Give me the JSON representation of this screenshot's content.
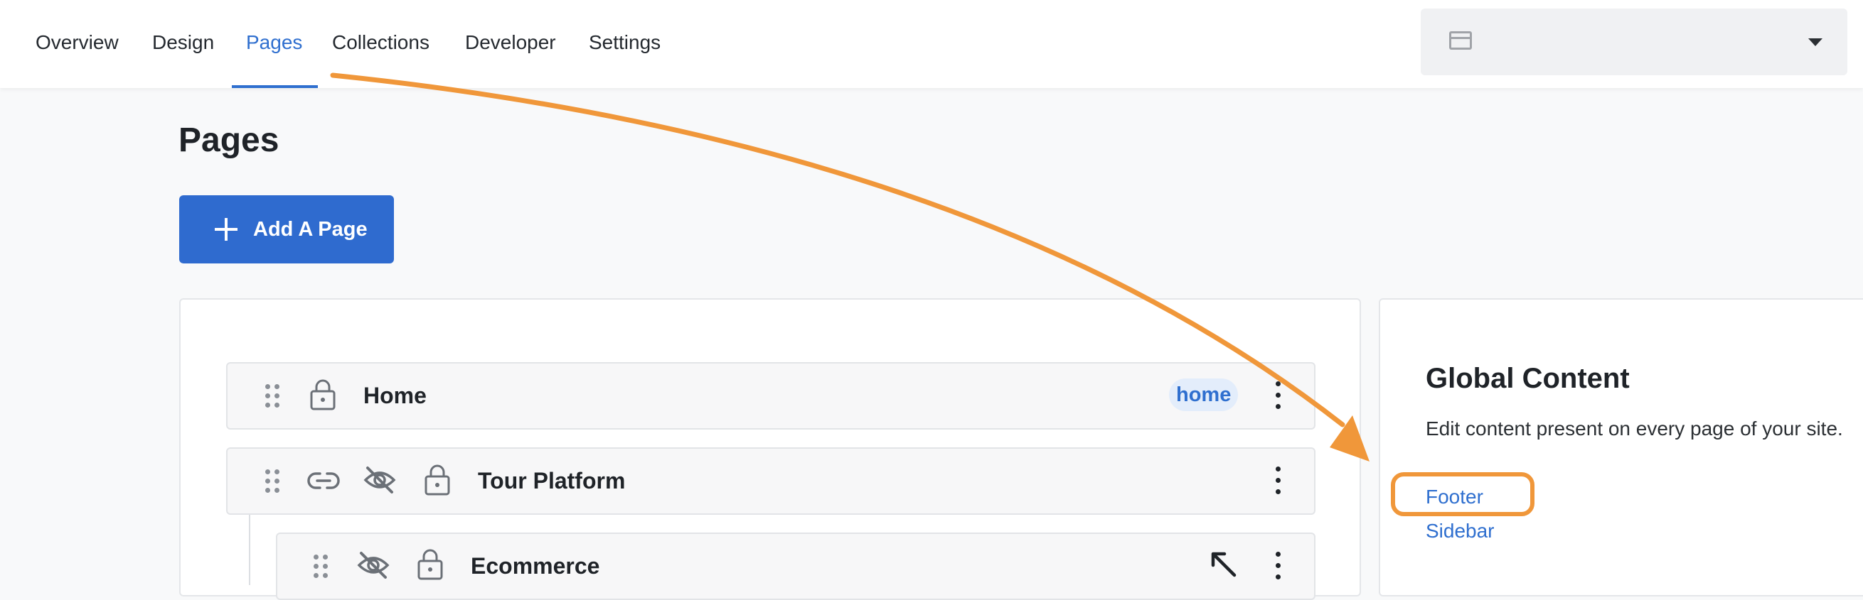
{
  "nav": {
    "tabs": [
      {
        "label": "Overview"
      },
      {
        "label": "Design"
      },
      {
        "label": "Pages"
      },
      {
        "label": "Collections"
      },
      {
        "label": "Developer"
      },
      {
        "label": "Settings"
      }
    ],
    "active_tab": "Pages",
    "site_selector": {
      "value": "",
      "icon": "window-icon"
    }
  },
  "main": {
    "title": "Pages",
    "add_button_label": "Add A Page",
    "pages": [
      {
        "title": "Home",
        "badge": "home",
        "icons": [
          "drag-handle-icon",
          "lock-icon"
        ]
      },
      {
        "title": "Tour Platform",
        "icons": [
          "drag-handle-icon",
          "link-icon",
          "eye-slash-icon",
          "lock-icon"
        ]
      },
      {
        "title": "Ecommerce",
        "icons": [
          "drag-handle-icon",
          "eye-slash-icon",
          "lock-icon"
        ]
      }
    ]
  },
  "global_content": {
    "title": "Global Content",
    "description": "Edit content present on every page of your site.",
    "links": [
      {
        "label": "Footer"
      },
      {
        "label": "Sidebar"
      }
    ]
  },
  "colors": {
    "accent": "#2f6fcf",
    "button": "#2f6bcf",
    "annotation": "#f0973a",
    "badge_bg": "#e3edfb"
  }
}
